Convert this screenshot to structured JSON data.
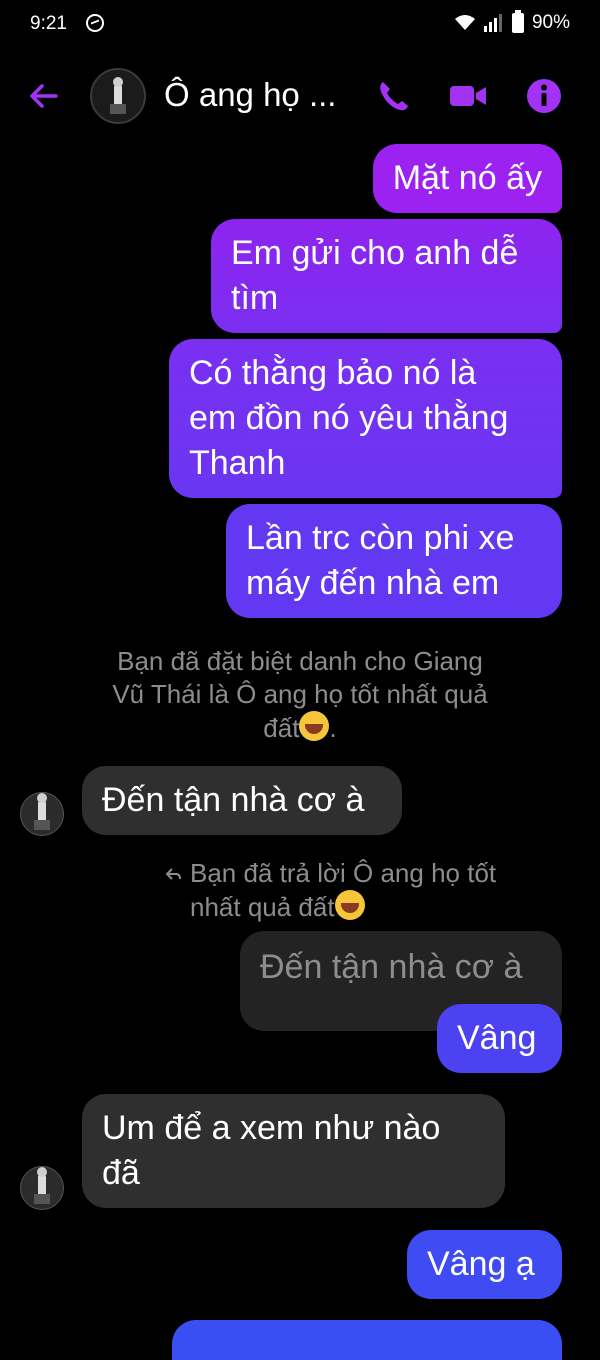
{
  "status_bar": {
    "time": "9:21",
    "battery": "90%"
  },
  "header": {
    "title": "Ô ang họ ..."
  },
  "messages": {
    "m1": "Mặt nó ấy",
    "m2_line1": "Em gửi cho anh dễ",
    "m2_line2": "tìm",
    "m3_line1": "Có thằng bảo nó là",
    "m3_line2": "em đồn nó yêu thằng",
    "m3_line3": "Thanh",
    "m4_line1": "Lần trc còn phi xe",
    "m4_line2": "máy đến nhà em",
    "system_line1": "Bạn đã đặt biệt danh cho Giang",
    "system_line2": "Vũ Thái là Ô ang họ tốt nhất quả",
    "system_line3": "đất",
    "system_tail": ".",
    "in1": "Đến tận nhà cơ à",
    "reply_line1": "Bạn đã trả lời Ô ang họ tốt",
    "reply_line2": "nhất quả đất",
    "quoted": "Đến tận nhà cơ à",
    "out_vang": "Vâng",
    "in2_line1": "Um để a xem như nào",
    "in2_line2": "đã",
    "out_vang_a": "Vâng ạ"
  },
  "colors": {
    "background": "#000000",
    "incoming": "#2f2f2f",
    "accent_purple": "#9b22f0",
    "accent_blue": "#3f4cf3"
  },
  "icons": [
    "back-arrow-icon",
    "phone-icon",
    "video-camera-icon",
    "info-icon",
    "reply-arrow-icon",
    "laughing-emoji-icon",
    "wifi-icon",
    "signal-icon",
    "battery-icon",
    "messenger-icon"
  ]
}
